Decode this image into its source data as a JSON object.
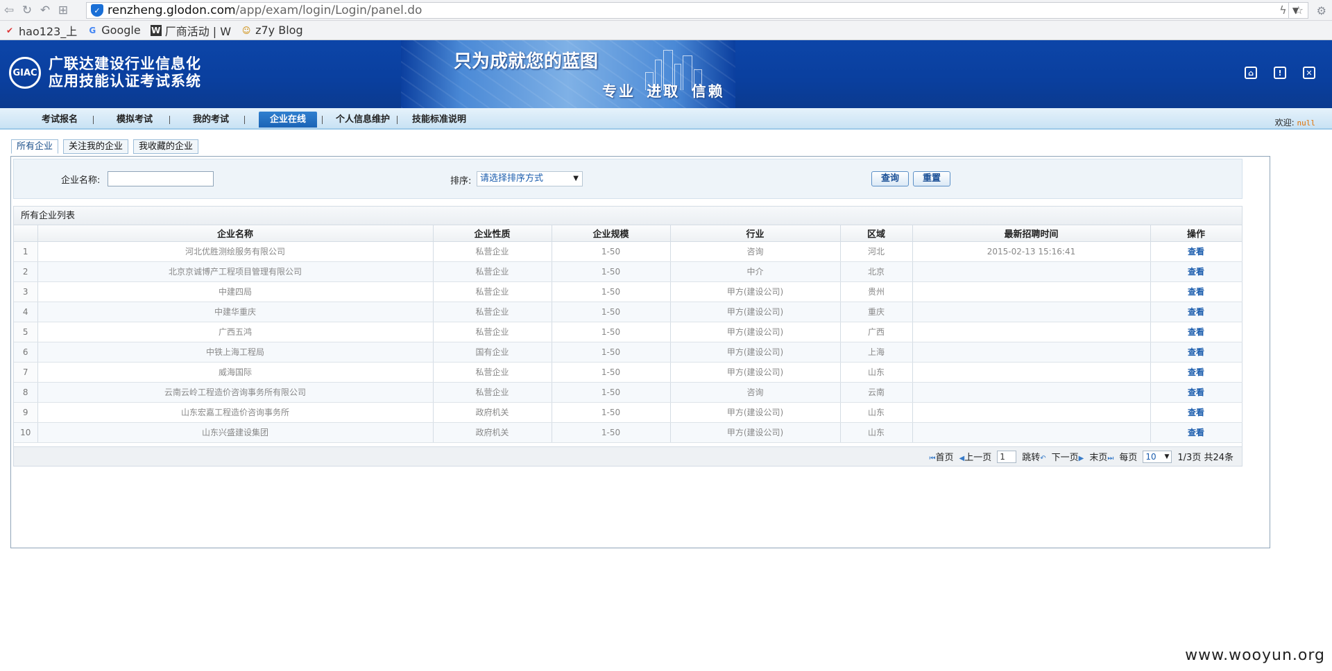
{
  "browser": {
    "url_host": "renzheng.glodon.com",
    "url_path": "/app/exam/login/Login/panel.do",
    "bookmarks": [
      {
        "label": "hao123_上"
      },
      {
        "label": "Google"
      },
      {
        "label": "厂商活动 | W"
      },
      {
        "label": "z7y Blog"
      }
    ]
  },
  "header": {
    "logo_text": "GIAC",
    "title_line1": "广联达建设行业信息化",
    "title_line2": "应用技能认证考试系统",
    "slogan_main": "只为成就您的蓝图",
    "slogan_sub": "专业 进取 信赖"
  },
  "menu": {
    "items": [
      "考试报名",
      "模拟考试",
      "我的考试",
      "企业在线",
      "个人信息维护",
      "技能标准说明"
    ],
    "welcome_label": "欢迎:",
    "welcome_user": "null"
  },
  "subtabs": [
    "所有企业",
    "关注我的企业",
    "我收藏的企业"
  ],
  "search": {
    "name_label": "企业名称:",
    "name_value": "",
    "sort_label": "排序:",
    "sort_value": "请选择排序方式",
    "query_button": "查询",
    "reset_button": "重置"
  },
  "list": {
    "title": "所有企业列表",
    "columns": [
      "",
      "企业名称",
      "企业性质",
      "企业规模",
      "行业",
      "区域",
      "最新招聘时间",
      "操作"
    ],
    "rows": [
      [
        "1",
        "河北优胜测绘服务有限公司",
        "私营企业",
        "1-50",
        "咨询",
        "河北",
        "2015-02-13 15:16:41",
        "查看"
      ],
      [
        "2",
        "北京京诚博产工程项目管理有限公司",
        "私营企业",
        "1-50",
        "中介",
        "北京",
        "",
        "查看"
      ],
      [
        "3",
        "中建四局",
        "私营企业",
        "1-50",
        "甲方(建设公司)",
        "贵州",
        "",
        "查看"
      ],
      [
        "4",
        "中建华重庆",
        "私营企业",
        "1-50",
        "甲方(建设公司)",
        "重庆",
        "",
        "查看"
      ],
      [
        "5",
        "广西五鸿",
        "私营企业",
        "1-50",
        "甲方(建设公司)",
        "广西",
        "",
        "查看"
      ],
      [
        "6",
        "中铁上海工程局",
        "国有企业",
        "1-50",
        "甲方(建设公司)",
        "上海",
        "",
        "查看"
      ],
      [
        "7",
        "威海国际",
        "私营企业",
        "1-50",
        "甲方(建设公司)",
        "山东",
        "",
        "查看"
      ],
      [
        "8",
        "云南云岭工程造价咨询事务所有限公司",
        "私营企业",
        "1-50",
        "咨询",
        "云南",
        "",
        "查看"
      ],
      [
        "9",
        "山东宏嘉工程造价咨询事务所",
        "政府机关",
        "1-50",
        "甲方(建设公司)",
        "山东",
        "",
        "查看"
      ],
      [
        "10",
        "山东兴盛建设集团",
        "政府机关",
        "1-50",
        "甲方(建设公司)",
        "山东",
        "",
        "查看"
      ]
    ]
  },
  "pager": {
    "first": "首页",
    "prev": "上一页",
    "page_value": "1",
    "jump": "跳转",
    "next": "下一页",
    "last": "末页",
    "per_page_label": "每页",
    "per_page_value": "10",
    "summary": "1/3页 共24条"
  },
  "watermark": "www.wooyun.org"
}
